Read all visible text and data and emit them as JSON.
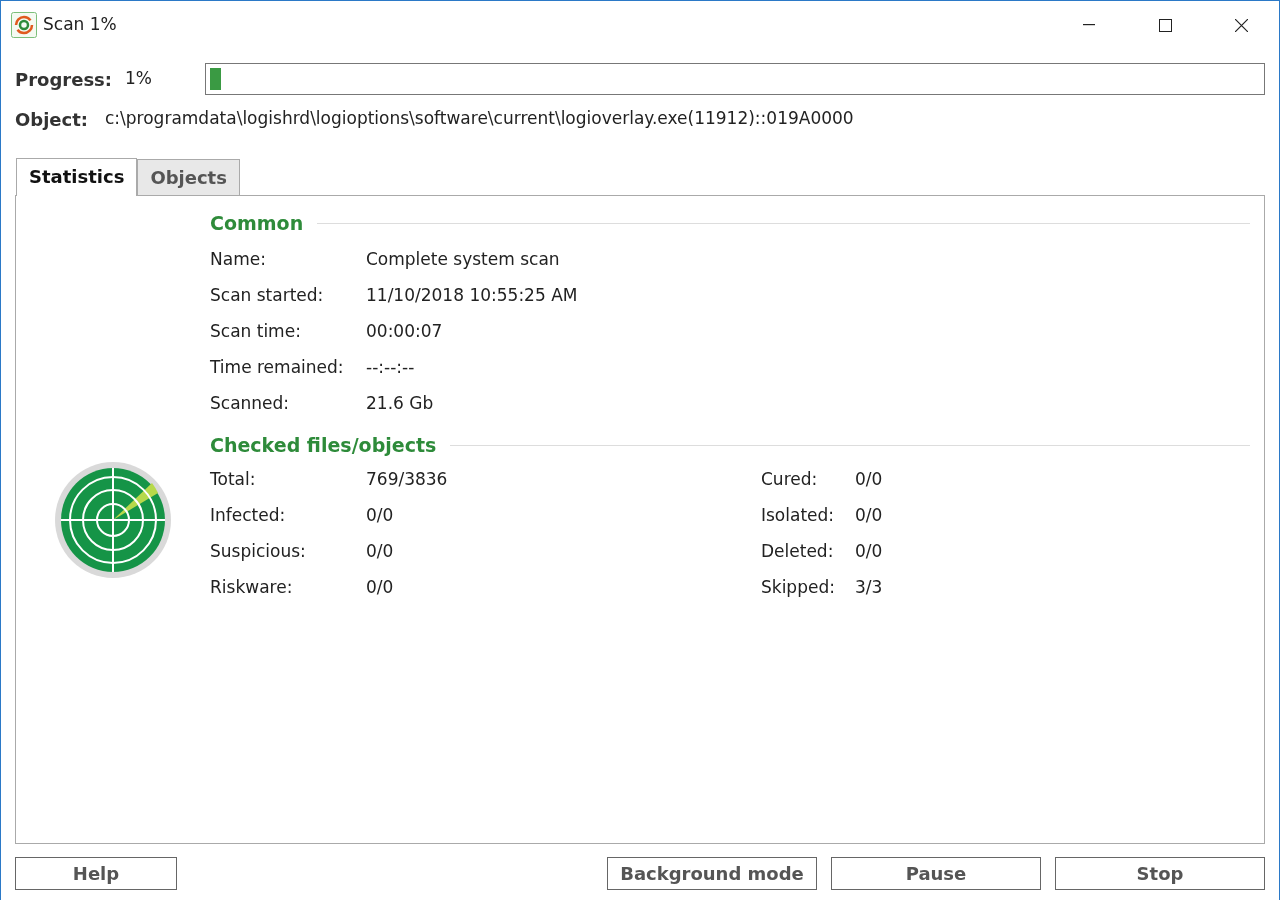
{
  "window": {
    "title": "Scan 1%"
  },
  "progress": {
    "label": "Progress:",
    "reading": "1%",
    "level": 0.01
  },
  "object": {
    "label": "Object:",
    "value": "c:\\programdata\\logishrd\\logioptions\\software\\current\\logioverlay.exe(11912)::019A0000"
  },
  "tabs": [
    {
      "label": "Statistics",
      "selected": true
    },
    {
      "label": "Objects",
      "selected": false
    }
  ],
  "common": {
    "title": "Common",
    "rows": [
      {
        "label": "Name:",
        "value": "Complete system scan"
      },
      {
        "label": "Scan started:",
        "value": "11/10/2018 10:55:25 AM"
      },
      {
        "label": "Scan time:",
        "value": "00:00:07"
      },
      {
        "label": "Time remained:",
        "value": "--:--:--"
      },
      {
        "label": "Scanned:",
        "value": "21.6 Gb"
      }
    ]
  },
  "checked": {
    "title": "Checked files/objects",
    "left": [
      {
        "label": "Total:",
        "value": "769/3836"
      },
      {
        "label": "Infected:",
        "value": "0/0"
      },
      {
        "label": "Suspicious:",
        "value": "0/0"
      },
      {
        "label": "Riskware:",
        "value": "0/0"
      }
    ],
    "right": [
      {
        "label": "Cured:",
        "value": "0/0"
      },
      {
        "label": "Isolated:",
        "value": "0/0"
      },
      {
        "label": "Deleted:",
        "value": "0/0"
      },
      {
        "label": "Skipped:",
        "value": "3/3"
      }
    ]
  },
  "buttons": {
    "left": [
      "Help"
    ],
    "right": [
      "Background mode",
      "Pause",
      "Stop"
    ]
  }
}
